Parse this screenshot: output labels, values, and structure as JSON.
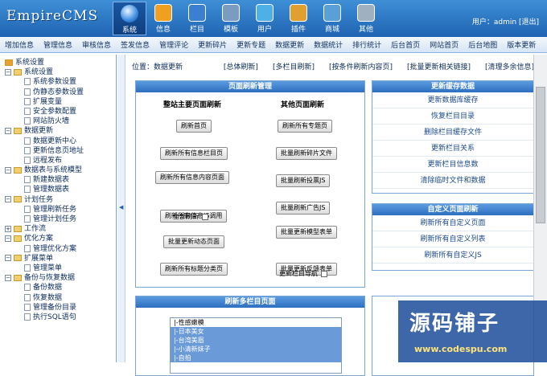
{
  "logo": "EmpireCMS",
  "nav": [
    "系统",
    "信息",
    "栏目",
    "模板",
    "用户",
    "插件",
    "商城",
    "其他"
  ],
  "user": {
    "label": "用户：",
    "name": "admin",
    "logout": "[退出]"
  },
  "menubar": [
    "增加信息",
    "管理信息",
    "审核信息",
    "签发信息",
    "管理评论",
    "更新碎片",
    "更新专题",
    "数据更新",
    "数据统计",
    "排行统计",
    "后台首页",
    "网站首页",
    "后台地图",
    "版本更新"
  ],
  "tree": [
    {
      "t": "系统设置",
      "lvl": 0,
      "k": "root"
    },
    {
      "t": "系统设置",
      "lvl": 1,
      "k": "folder"
    },
    {
      "t": "系统参数设置",
      "lvl": 2,
      "k": "page"
    },
    {
      "t": "伪静态参数设置",
      "lvl": 2,
      "k": "page"
    },
    {
      "t": "扩展变量",
      "lvl": 2,
      "k": "page"
    },
    {
      "t": "安全参数配置",
      "lvl": 2,
      "k": "page"
    },
    {
      "t": "网站防火墙",
      "lvl": 2,
      "k": "page"
    },
    {
      "t": "数据更新",
      "lvl": 1,
      "k": "folder"
    },
    {
      "t": "数据更新中心",
      "lvl": 2,
      "k": "page"
    },
    {
      "t": "更新信息页地址",
      "lvl": 2,
      "k": "page"
    },
    {
      "t": "远程发布",
      "lvl": 2,
      "k": "page"
    },
    {
      "t": "数据表与系统模型",
      "lvl": 1,
      "k": "folder"
    },
    {
      "t": "新建数据表",
      "lvl": 2,
      "k": "page"
    },
    {
      "t": "管理数据表",
      "lvl": 2,
      "k": "page"
    },
    {
      "t": "计划任务",
      "lvl": 1,
      "k": "folder"
    },
    {
      "t": "管理刷新任务",
      "lvl": 2,
      "k": "page"
    },
    {
      "t": "管理计划任务",
      "lvl": 2,
      "k": "page"
    },
    {
      "t": "工作流",
      "lvl": 1,
      "k": "folder-closed"
    },
    {
      "t": "优化方案",
      "lvl": 1,
      "k": "folder"
    },
    {
      "t": "管理优化方案",
      "lvl": 2,
      "k": "page"
    },
    {
      "t": "扩展菜单",
      "lvl": 1,
      "k": "folder"
    },
    {
      "t": "管理菜单",
      "lvl": 2,
      "k": "page"
    },
    {
      "t": "备份与恢复数据",
      "lvl": 1,
      "k": "folder"
    },
    {
      "t": "备份数据",
      "lvl": 2,
      "k": "page"
    },
    {
      "t": "恢复数据",
      "lvl": 2,
      "k": "page"
    },
    {
      "t": "管理备份目录",
      "lvl": 2,
      "k": "page"
    },
    {
      "t": "执行SQL语句",
      "lvl": 2,
      "k": "page"
    }
  ],
  "crumbs": {
    "pos": "位置：",
    "page": "数据更新",
    "links": [
      "[总体刷新]",
      "[多栏目刷新]",
      "[按条件刷新内容页]",
      "[批量更新相关链接]",
      "[清理多余信息]"
    ]
  },
  "refresh": {
    "title": "页面刷新管理",
    "col1": "整站主要页面刷新",
    "col2": "其他页面刷新",
    "left": [
      "刷新首页",
      "刷新所有信息栏目页",
      "刷新所有信息内容页面",
      "刷新所有信息JS调用",
      "批量更新动态页面",
      "刷新所有标题分类页"
    ],
    "all_refresh": "全部刷新",
    "right": [
      "刷新所有专题页",
      "批量刷新碎片文件",
      "批量刷新投票JS",
      "批量刷新广告JS",
      "批量更新模型表单",
      "批量更新反馈表单"
    ],
    "nav_update": "更新栏目导航"
  },
  "cache": {
    "title": "更新缓存数据",
    "links": [
      "更新数据库缓存",
      "恢复栏目目录",
      "删除栏目缓存文件",
      "更新栏目关系",
      "更新栏目信息数",
      "清除临时文件和数据"
    ]
  },
  "custom": {
    "title": "自定义页面刷新",
    "links": [
      "刷新所有自定义页面",
      "刷新所有自定义列表",
      "刷新所有自定义JS"
    ]
  },
  "multi": {
    "title": "刷新多栏目页面",
    "items": [
      "|-性感嫩模",
      "|-日本美女",
      "|-台湾美眉",
      "|-小清新妹子",
      "|-自拍"
    ]
  },
  "watermark": {
    "main": "源码铺子",
    "url": "www.codespu.com"
  }
}
